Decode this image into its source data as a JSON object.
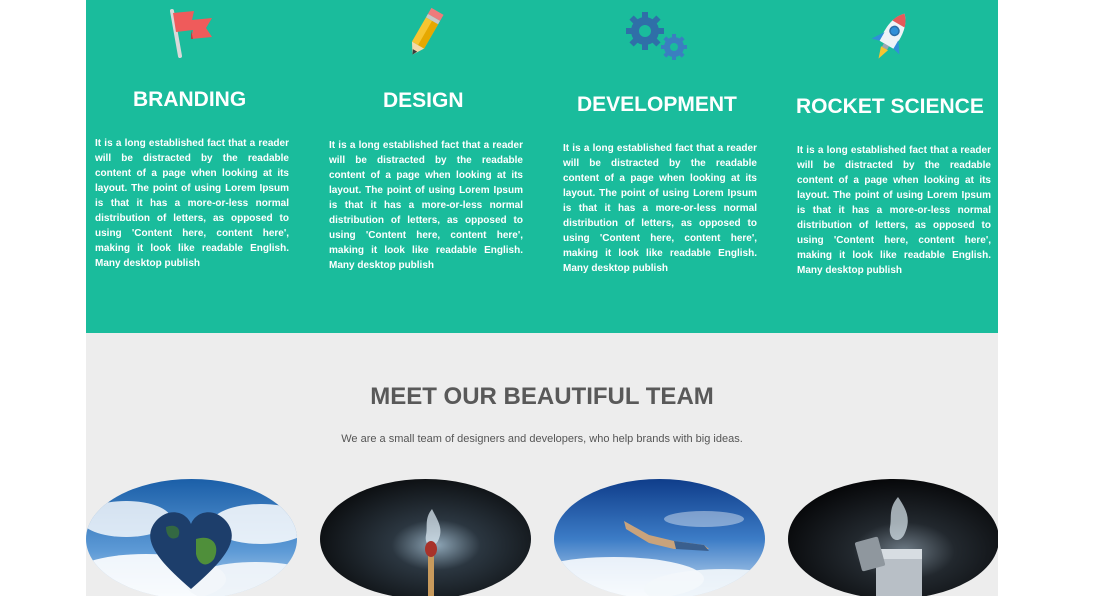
{
  "services": {
    "background": "#1abc9c",
    "items": [
      {
        "title": "BRANDING",
        "icon": "flag-icon",
        "text": "It is a long established fact that a reader will be distracted by the readable content of a page when looking at its layout. The point of using Lorem Ipsum is that it has a more-or-less normal distribution of letters, as opposed to using 'Content here, content here', making it look like readable English. Many desktop publish"
      },
      {
        "title": "DESIGN",
        "icon": "pencil-icon",
        "text": "It is a long established fact that a reader will be distracted by the readable content of a page when looking at its layout. The point of using Lorem Ipsum is that it has a more-or-less normal distribution of letters, as opposed to using 'Content here, content here', making it look like readable English. Many desktop publish"
      },
      {
        "title": "DEVELOPMENT",
        "icon": "gears-icon",
        "text": "It is a long established fact that a reader will be distracted by the readable content of a page when looking at its layout. The point of using Lorem Ipsum is that it has a more-or-less normal distribution of letters, as opposed to using 'Content here, content here', making it look like readable English. Many desktop publish"
      },
      {
        "title": "ROCKET SCIENCE",
        "icon": "rocket-icon",
        "text": "It is a long established fact that a reader will be distracted by the readable content of a page when looking at its layout. The point of using Lorem Ipsum is that it has a more-or-less normal distribution of letters, as opposed to using 'Content here, content here', making it look like readable English. Many desktop publish"
      }
    ]
  },
  "team": {
    "background": "#ededed",
    "title": "MEET OUR BEAUTIFUL TEAM",
    "subtitle": "We are a small team of designers and developers, who help brands with big ideas.",
    "photos": [
      "heart-earth-photo",
      "match-splash-photo",
      "skydiver-photo",
      "lighter-splash-photo"
    ]
  }
}
